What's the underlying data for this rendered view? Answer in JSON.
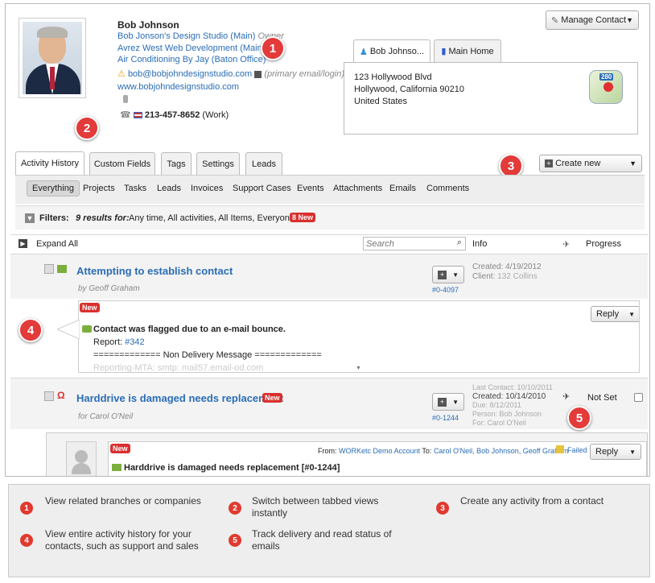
{
  "contact": {
    "name": "Bob Johnson",
    "org1": "Bob Jonson's Design Studio (Main)",
    "org1_role": "Owner",
    "org2": "Avrez West Web Development (Main)",
    "org3": "Air Conditioning By Jay (Baton Office)",
    "email": "bob@bobjohndesignstudio.com",
    "email_note": "(primary email/login)",
    "website": "www.bobjohndesignstudio.com",
    "phone": "213-457-8652",
    "phone_type": "(Work)"
  },
  "manage_label": "Manage Contact",
  "address": {
    "tabs": [
      "Bob Johnso...",
      "Main Home"
    ],
    "line1": "123 Hollywood Blvd",
    "line2": "Hollywood, California 90210",
    "line3": "United States",
    "map_badge": "280"
  },
  "tabs": [
    "Activity History",
    "Custom Fields",
    "Tags",
    "Settings",
    "Leads"
  ],
  "create_new": "Create new",
  "subtabs": [
    "Everything",
    "Projects",
    "Tasks",
    "Leads",
    "Invoices",
    "Support Cases",
    "Events",
    "Attachments",
    "Emails",
    "Comments"
  ],
  "filters": {
    "label": "Filters:",
    "text": "9 results for:",
    "criteria": "Any time, All activities, All Items, Everyone",
    "new_badge": "8 New"
  },
  "list_header": {
    "expand": "Expand All",
    "search_placeholder": "Search",
    "info": "Info",
    "progress": "Progress"
  },
  "activity1": {
    "title": "Attempting to establish contact",
    "by": "by Geoff Graham",
    "id": "#0-4097",
    "created": "Created: 4/19/2012",
    "client_label": "Client:",
    "client": "132 Collins"
  },
  "email1": {
    "new": "New",
    "reply": "Reply",
    "subject": "Contact was flagged due to an e-mail bounce.",
    "report_label": "Report:",
    "report": "#342",
    "delivery": "============= Non Delivery Message =============",
    "mta": "Reporting-MTA: smtp: mail57.email-od.com"
  },
  "activity2": {
    "title": "Harddrive is damaged needs replacement",
    "new": "New",
    "for": "for Carol O'Neil",
    "id": "#0-1244",
    "last_contact": "Last Contact: 10/10/2011",
    "created": "Created: 10/14/2010",
    "due": "Due: 8/12/2011",
    "person": "Person: Bob Johnson",
    "for2": "For: Carol O'Neil",
    "status": "Not Set"
  },
  "email2": {
    "new": "New",
    "from_label": "From:",
    "from": "WORKetc Demo Account",
    "to_label": "To:",
    "to": "Carol O'Neil, Bob Johnson, Geoff Graham",
    "failed": "Failed",
    "reply": "Reply",
    "subject": "Harddrive is damaged needs replacement [#0-1244]"
  },
  "badges": [
    "1",
    "2",
    "3",
    "4",
    "5"
  ],
  "legend": [
    {
      "n": "1",
      "text": "View related branches or companies"
    },
    {
      "n": "2",
      "text": "Switch between tabbed views instantly"
    },
    {
      "n": "3",
      "text": "Create any activity from a contact"
    },
    {
      "n": "4",
      "text": "View entire activity history for your contacts, such as support and sales"
    },
    {
      "n": "5",
      "text": "Track delivery and read status of emails"
    }
  ],
  "colors": {
    "badge": "#e33a3a",
    "link": "#2a6db5"
  }
}
